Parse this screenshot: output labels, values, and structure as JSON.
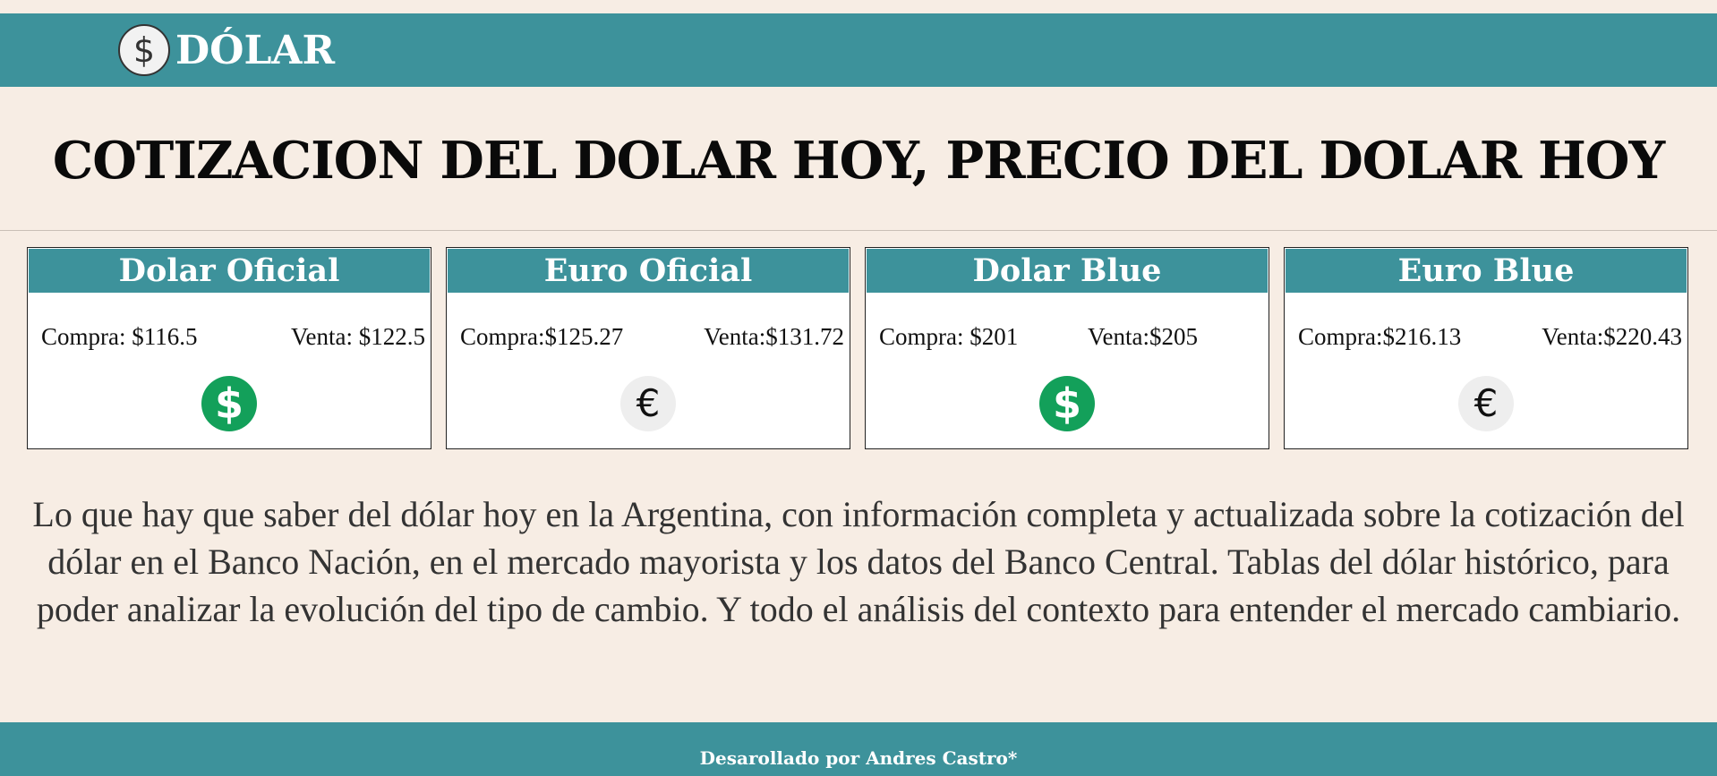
{
  "header": {
    "logo_icon": "dollar-coin-icon",
    "logo_symbol": "$",
    "brand": "DÓLAR"
  },
  "page_title": "COTIZACION DEL DOLAR HOY, PRECIO DEL DOLAR HOY",
  "cards": [
    {
      "title": "Dolar Oficial",
      "compra": "Compra: $116.5",
      "venta": "Venta: $122.5",
      "icon": "dollar-coin-icon",
      "symbol": "$",
      "icon_color": "#13a05a"
    },
    {
      "title": "Euro Oficial",
      "compra": "Compra:$125.27",
      "venta": "Venta:$131.72",
      "icon": "euro-coin-icon",
      "symbol": "€",
      "icon_color": "#eeeeee"
    },
    {
      "title": "Dolar Blue",
      "compra": "Compra: $201",
      "venta": "Venta:$205",
      "icon": "dollar-coin-icon",
      "symbol": "$",
      "icon_color": "#13a05a"
    },
    {
      "title": "Euro Blue",
      "compra": "Compra:$216.13",
      "venta": "Venta:$220.43",
      "icon": "euro-coin-icon",
      "symbol": "€",
      "icon_color": "#eeeeee"
    }
  ],
  "description": "Lo que hay que saber del dólar hoy en la Argentina, con información completa y actualizada sobre la cotización del dólar en el Banco Nación, en el mercado mayorista y los datos del Banco Central. Tablas del dólar histórico, para poder analizar la evolución del tipo de cambio. Y todo el análisis del contexto para entender el mercado cambiario.",
  "footer": {
    "text": "Desarollado por Andres Castro*"
  },
  "colors": {
    "background": "#f7ede4",
    "accent": "#3d929b",
    "dollar_green": "#13a05a"
  }
}
